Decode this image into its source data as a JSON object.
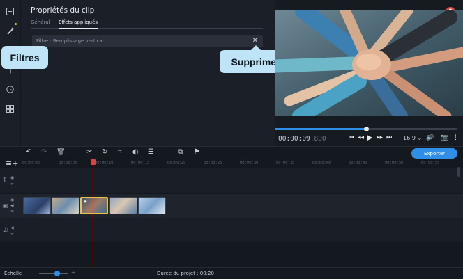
{
  "panel": {
    "title": "Propriétés du clip",
    "tabs": [
      "Général",
      "Effets appliqués"
    ],
    "active_tab": "Effets appliqués",
    "effect_label": "Filtre : Remplissage vertical"
  },
  "callouts": {
    "filtres": "Filtres",
    "supprimer": "Supprimer"
  },
  "player": {
    "help": "?",
    "time_main": "00:00:09",
    "time_ms": ".800",
    "ratio": "16:9",
    "progress": 0.5
  },
  "toolbar": {
    "export_label": "Exporter"
  },
  "ruler": {
    "ticks": [
      "00:00:00",
      "00:00:05",
      "00:00:10",
      "00:00:15",
      "00:00:20",
      "00:00:25",
      "00:00:30",
      "00:00:35",
      "00:00:40",
      "00:00:45",
      "00:00:50",
      "00:00:55"
    ]
  },
  "status": {
    "scale_label": "Échelle :",
    "duration_label": "Durée du projet : 00:20"
  },
  "icons": {
    "sidebar": [
      "import-icon",
      "magic-wand-icon",
      "text-icon",
      "clock-icon",
      "grid-icon"
    ],
    "toolbar": [
      "undo-icon",
      "redo-icon",
      "trash-icon",
      "cut-icon",
      "rotate-icon",
      "crop-icon",
      "color-icon",
      "adjust-icon",
      "pip-icon",
      "flag-icon"
    ]
  },
  "colors": {
    "accent": "#2f8ee6",
    "playhead": "#d9463e",
    "selected_clip": "#e8c445",
    "callout": "#bfe3f7"
  }
}
